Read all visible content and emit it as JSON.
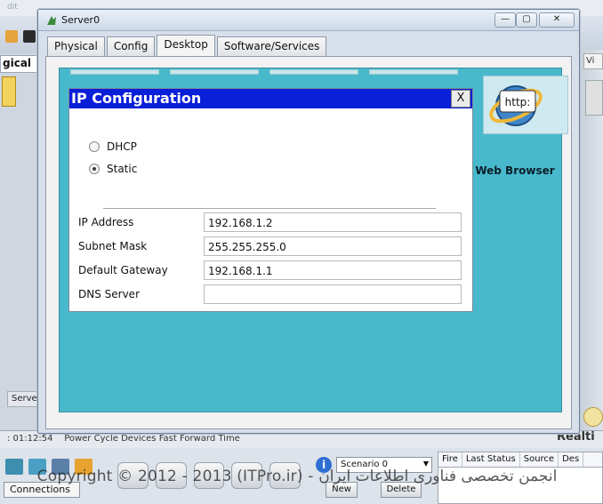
{
  "background": {
    "menu_text": "dit",
    "logical_tab": "gical",
    "right_tab": "Vi",
    "server_label": "Serve",
    "timebar": {
      "time": ": 01:12:54",
      "controls": "Power Cycle Devices   Fast Forward Time"
    },
    "realtime_label": "Realti",
    "connections_label": "Connections",
    "scenario": {
      "info_glyph": "i",
      "select_value": "Scenario 0",
      "new_button": "New",
      "delete_button": "Delete"
    },
    "pdu_columns": [
      "Fire",
      "Last Status",
      "Source",
      "Des"
    ]
  },
  "watermark_text": "Copyright © 2012 - 2013 (ITPro.ir) - انجمن تخصصی فناوری اطلاعات ایران",
  "window": {
    "title": "Server0",
    "controls": {
      "minimize": "—",
      "maximize": "▢",
      "close": "✕"
    },
    "tabs": [
      "Physical",
      "Config",
      "Desktop",
      "Software/Services"
    ],
    "active_tab": "Desktop"
  },
  "web_browser": {
    "icon_text": "http:",
    "label": "Web Browser"
  },
  "ip_config": {
    "title": "IP Configuration",
    "close_label": "X",
    "mode_options": [
      "DHCP",
      "Static"
    ],
    "selected_mode": "Static",
    "fields": [
      {
        "label": "IP Address",
        "value": "192.168.1.2"
      },
      {
        "label": "Subnet Mask",
        "value": "255.255.255.0"
      },
      {
        "label": "Default Gateway",
        "value": "192.168.1.1"
      },
      {
        "label": "DNS Server",
        "value": ""
      }
    ]
  },
  "colors": {
    "dialog_header": "#0a1fd8",
    "desktop_background": "#48b9cc"
  }
}
